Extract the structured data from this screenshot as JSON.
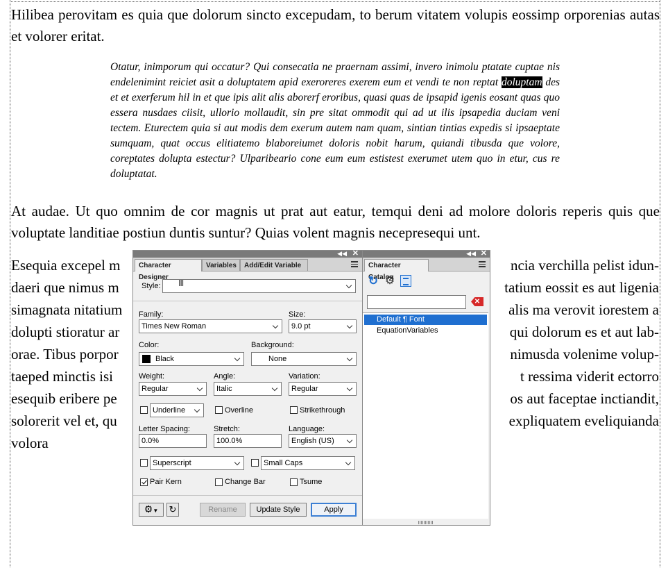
{
  "document": {
    "para1": "Hilibea perovitam es quia que dolorum sincto excepudam, to berum vitatem volupis eossimp orporenias autas et volorer eritat.",
    "quote_before": "Otatur, inimporum qui occatur? Qui consecatia ne praernam assimi, invero inimolu ptatate cuptae nis endelenimint reiciet asit a doluptatem apid exeroreres exerem eum et vendi te non reptat ",
    "quote_highlight": "doluptam",
    "quote_after": " des et et exerferum hil in et que ipis alit alis aborerf eroribus, quasi quas de ipsapid igenis eosant quas quo essera nusdaes ciisit, ullorio mollaudit, sin pre sitat ommodit qui ad ut ilis ipsapedia duciam veni tectem. Eturectem quia si aut modis dem exerum autem nam quam, sintian tintias expedis si ipsaeptate sumquam, quat occus elitiatemo blaboreiumet doloris nobit harum, quiandi tibusda que volore, coreptates dolupta estectur? Ulparibeario cone eum eum estistest exerumet utem quo in etur, cus re doluptatat.",
    "para2": "At audae. Ut quo omnim de cor magnis ut prat aut eatur, temqui deni ad molore doloris reperis quis que voluptate landitiae postiun duntis suntur? Quias volent magnis necepresequi unt.",
    "para3_lines": [
      "Esequia excepel m",
      "daeri que nimus m",
      "simagnata nitatium",
      "dolupti stioratur ar",
      "orae. Tibus porpor",
      "taeped minctis isi",
      "esequib eribere pe",
      "solorerit vel et, qu",
      "volora"
    ],
    "para3_right_lines": [
      "ncia verchilla pelist idun-",
      "tatium eossit es aut ligenia",
      "alis ma verovit iorestem a",
      "qui dolorum es et aut lab-",
      "nimusda volenime volup-",
      "t ressima viderit ectorro",
      "os aut faceptae inctiandit,",
      "expliquatem eveliquianda"
    ]
  },
  "designer": {
    "tabs": [
      "Character Designer",
      "Variables",
      "Add/Edit Variable"
    ],
    "style_label": "Style:",
    "style_value": "",
    "family_label": "Family:",
    "family_value": "Times New Roman",
    "size_label": "Size:",
    "size_value": "9.0 pt",
    "color_label": "Color:",
    "color_value": "Black",
    "color_swatch": "#000000",
    "background_label": "Background:",
    "background_value": "None",
    "weight_label": "Weight:",
    "weight_value": "Regular",
    "angle_label": "Angle:",
    "angle_value": "Italic",
    "variation_label": "Variation:",
    "variation_value": "Regular",
    "underline_value": "Underline",
    "overline_label": "Overline",
    "strikethrough_label": "Strikethrough",
    "letter_spacing_label": "Letter Spacing:",
    "letter_spacing_value": "0.0%",
    "stretch_label": "Stretch:",
    "stretch_value": "100.0%",
    "language_label": "Language:",
    "language_value": "English (US)",
    "superscript_value": "Superscript",
    "small_caps_value": "Small Caps",
    "pair_kern_label": "Pair Kern",
    "pair_kern_checked": true,
    "change_bar_label": "Change Bar",
    "tsume_label": "Tsume",
    "rename_label": "Rename",
    "update_style_label": "Update Style",
    "apply_label": "Apply"
  },
  "catalog": {
    "tab": "Character Catalog",
    "search_value": "",
    "items": [
      "Default ¶ Font",
      "EquationVariables"
    ],
    "selected_index": 0
  }
}
